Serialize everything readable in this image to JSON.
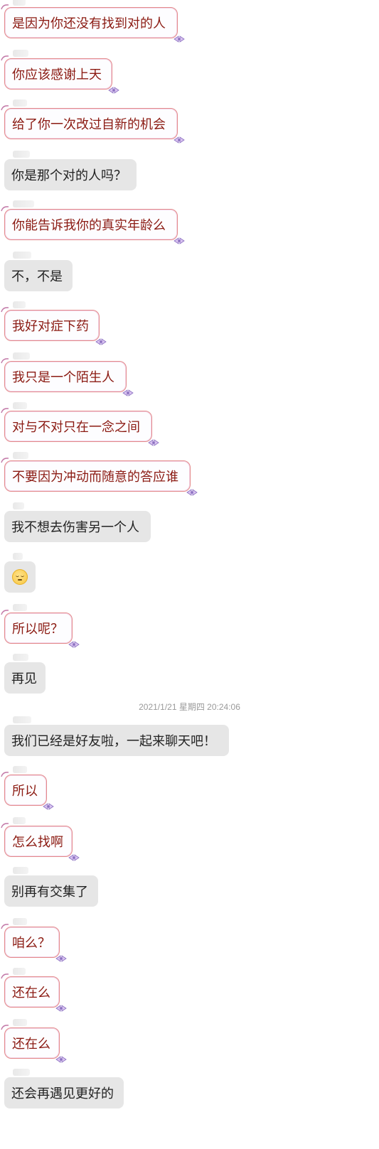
{
  "conversation": {
    "timestamp": "2021/1/21 星期四 20:24:06",
    "messages": [
      {
        "text": "是因为你还没有找到对的人",
        "side": "friend"
      },
      {
        "text": "你应该感谢上天",
        "side": "friend"
      },
      {
        "text": "给了你一次改过自新的机会",
        "side": "friend"
      },
      {
        "text": "你是那个对的人吗？",
        "side": "self"
      },
      {
        "text": "你能告诉我你的真实年龄么",
        "side": "friend"
      },
      {
        "text": "不，不是",
        "side": "self"
      },
      {
        "text": "我好对症下药",
        "side": "friend"
      },
      {
        "text": "我只是一个陌生人",
        "side": "friend"
      },
      {
        "text": "对与不对只在一念之间",
        "side": "friend"
      },
      {
        "text": "不要因为冲动而随意的答应谁",
        "side": "friend"
      },
      {
        "text": "我不想去伤害另一个人",
        "side": "self"
      },
      {
        "text": "",
        "side": "self",
        "icon": "pensive-face-emoji-icon"
      },
      {
        "text": "所以呢？",
        "side": "friend"
      },
      {
        "text": "再见",
        "side": "self"
      },
      {
        "text": "我们已经是好友啦，一起来聊天吧！",
        "side": "self"
      },
      {
        "text": "所以",
        "side": "friend"
      },
      {
        "text": "怎么找啊",
        "side": "friend"
      },
      {
        "text": "别再有交集了",
        "side": "self"
      },
      {
        "text": "咱么？",
        "side": "friend"
      },
      {
        "text": "还在么",
        "side": "friend"
      },
      {
        "text": "还在么",
        "side": "friend"
      },
      {
        "text": "还会再遇见更好的",
        "side": "self"
      }
    ]
  },
  "colors": {
    "friend_text": "#8b1a12",
    "friend_border": "#e38a8a",
    "self_bubble": "#e6e6e6",
    "self_text": "#222222",
    "timestamp": "#9a9a9a"
  }
}
